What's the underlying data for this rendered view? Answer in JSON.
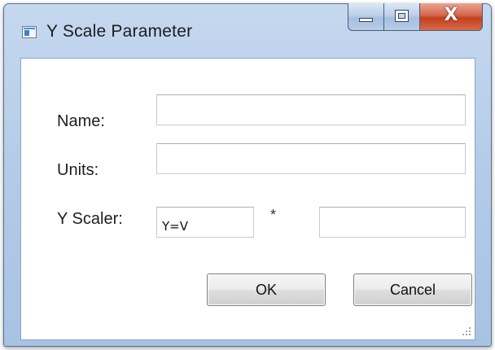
{
  "window": {
    "title": "Y Scale Parameter",
    "icon": "window-app-icon",
    "caption_buttons": {
      "minimize_icon": "minimize-icon",
      "maximize_icon": "maximize-icon",
      "close_glyph": "X"
    }
  },
  "form": {
    "name_label": "Name:",
    "name_value": "",
    "units_label": "Units:",
    "units_value": "",
    "scaler_label": "Y Scaler:",
    "scaler_value": "Y=V",
    "multiply_sign": "*",
    "factor_value": ""
  },
  "buttons": {
    "ok_label": "OK",
    "cancel_label": "Cancel"
  },
  "colors": {
    "frame": "#b3cbe8",
    "close_button": "#c2401f",
    "client_background": "#ffffff"
  }
}
